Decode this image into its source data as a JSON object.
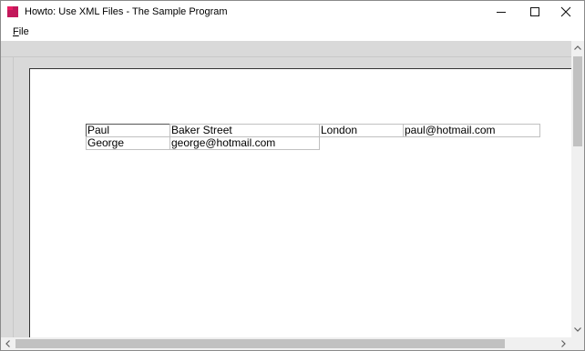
{
  "window": {
    "title": "Howto: Use XML Files - The Sample Program",
    "icon_label": "TX"
  },
  "menu": {
    "file_label_accel": "F",
    "file_label_rest": "ile"
  },
  "table": {
    "rows": [
      [
        "Paul",
        "Baker Street",
        "London",
        "paul@hotmail.com"
      ],
      [
        "George",
        "george@hotmail.com"
      ]
    ]
  },
  "icons": {
    "app": "tx-app-icon",
    "minimize": "minimize-icon",
    "maximize": "maximize-icon",
    "close": "close-icon",
    "scroll_up": "chevron-up-icon",
    "scroll_down": "chevron-down-icon",
    "scroll_left": "chevron-left-icon",
    "scroll_right": "chevron-right-icon"
  },
  "colors": {
    "icon_accent": "#c2185b",
    "workspace": "#d9d9d9",
    "scrollbar_thumb": "#c1c1c1"
  }
}
